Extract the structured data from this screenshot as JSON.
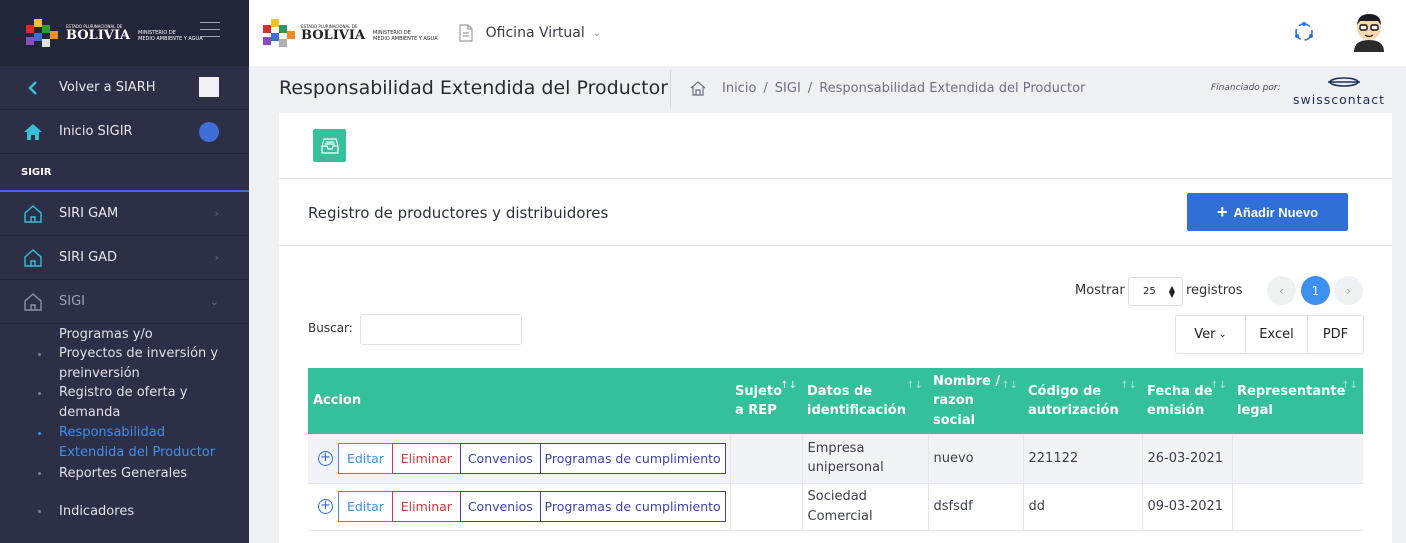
{
  "sidebar": {
    "logo": {
      "line1": "ESTADO PLURINACIONAL DE",
      "line2": "BOLIVIA",
      "line3": "MINISTERIO DE",
      "line4": "MEDIO AMBIENTE Y AGUA"
    },
    "back_label": "Volver a SIARH",
    "home_label": "Inicio SIGIR",
    "section_label": "SIGIR",
    "groups": [
      {
        "label": "SIRI GAM"
      },
      {
        "label": "SIRI GAD"
      },
      {
        "label": "SIGI"
      }
    ],
    "sub_items": [
      {
        "label": "Programas y/o"
      },
      {
        "label": "Proyectos de inversión y preinversión"
      },
      {
        "label": "Registro de oferta y demanda"
      },
      {
        "label": "Responsabilidad Extendida del Productor"
      },
      {
        "label": "Reportes Generales"
      },
      {
        "label": "Indicadores"
      }
    ]
  },
  "topbar": {
    "logo": {
      "line1": "ESTADO PLURINACIONAL DE",
      "line2": "BOLIVIA",
      "line3": "MINISTERIO DE",
      "line4": "MEDIO AMBIENTE Y AGUA"
    },
    "app_label": "Oficina Virtual"
  },
  "page": {
    "title": "Responsabilidad Extendida del Productor",
    "breadcrumb": [
      "Inicio",
      "SIGI",
      "Responsabilidad Extendida del Productor"
    ],
    "funded_label": "Financiado por:",
    "sponsor": "swisscontact"
  },
  "card": {
    "subtitle": "Registro de productores y distribuidores",
    "add_button": "Añadir Nuevo",
    "show_label": "Mostrar",
    "page_length": "25",
    "records_label": "registros",
    "current_page": "1",
    "search_label": "Buscar:",
    "search_value": "",
    "export_buttons": [
      "Ver",
      "Excel",
      "PDF"
    ]
  },
  "table": {
    "columns": [
      "Accion",
      "Sujeto a REP",
      "Datos de identificación",
      "Nombre / razon social",
      "Código de autorización",
      "Fecha de emisión",
      "Representante legal"
    ],
    "action_labels": [
      "Editar",
      "Eliminar",
      "Convenios",
      "Programas de cumplimiento"
    ],
    "rows": [
      {
        "sujeto": "",
        "datos": "Empresa unipersonal",
        "nombre": "nuevo",
        "codigo": "221122",
        "fecha": "26-03-2021",
        "representante": ""
      },
      {
        "sujeto": "",
        "datos": "Sociedad Comercial",
        "nombre": "dsfsdf",
        "codigo": "dd",
        "fecha": "09-03-2021",
        "representante": ""
      }
    ]
  },
  "colors": {
    "teal": "#35c09c",
    "primary": "#2f6fd6",
    "sidebar": "#2c2f45",
    "danger": "#e0343f"
  }
}
